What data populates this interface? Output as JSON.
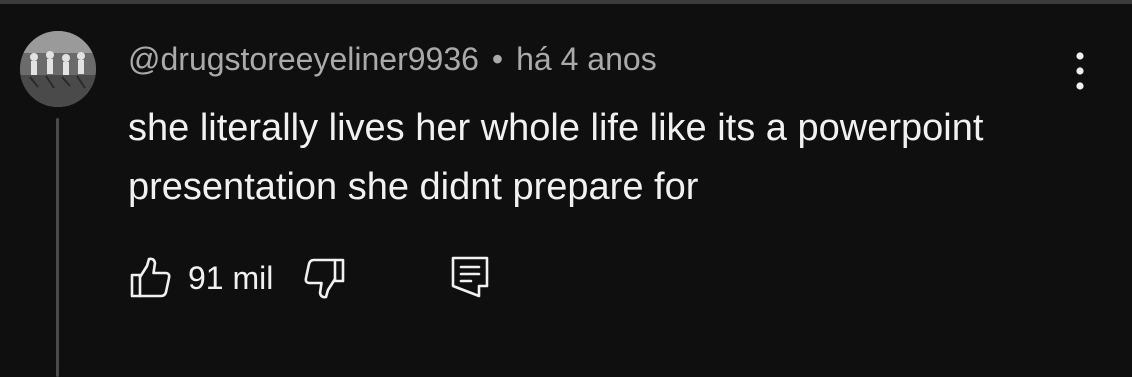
{
  "comment": {
    "author": "@drugstoreeyeliner9936",
    "separator": "•",
    "timestamp": "há 4 anos",
    "text": "she literally lives her whole life like its a powerpoint presentation she didnt prepare for",
    "avatar_icon": "avatar-image",
    "more_icon": "vertical-ellipsis-icon"
  },
  "actions": {
    "like_icon": "thumbs-up-icon",
    "like_count": "91 mil",
    "dislike_icon": "thumbs-down-icon",
    "reply_icon": "reply-comment-icon"
  },
  "colors": {
    "background": "#0f0f0f",
    "primary_text": "#f1f1f1",
    "secondary_text": "#aaaaaa",
    "thread_line": "#4a4a4a"
  }
}
